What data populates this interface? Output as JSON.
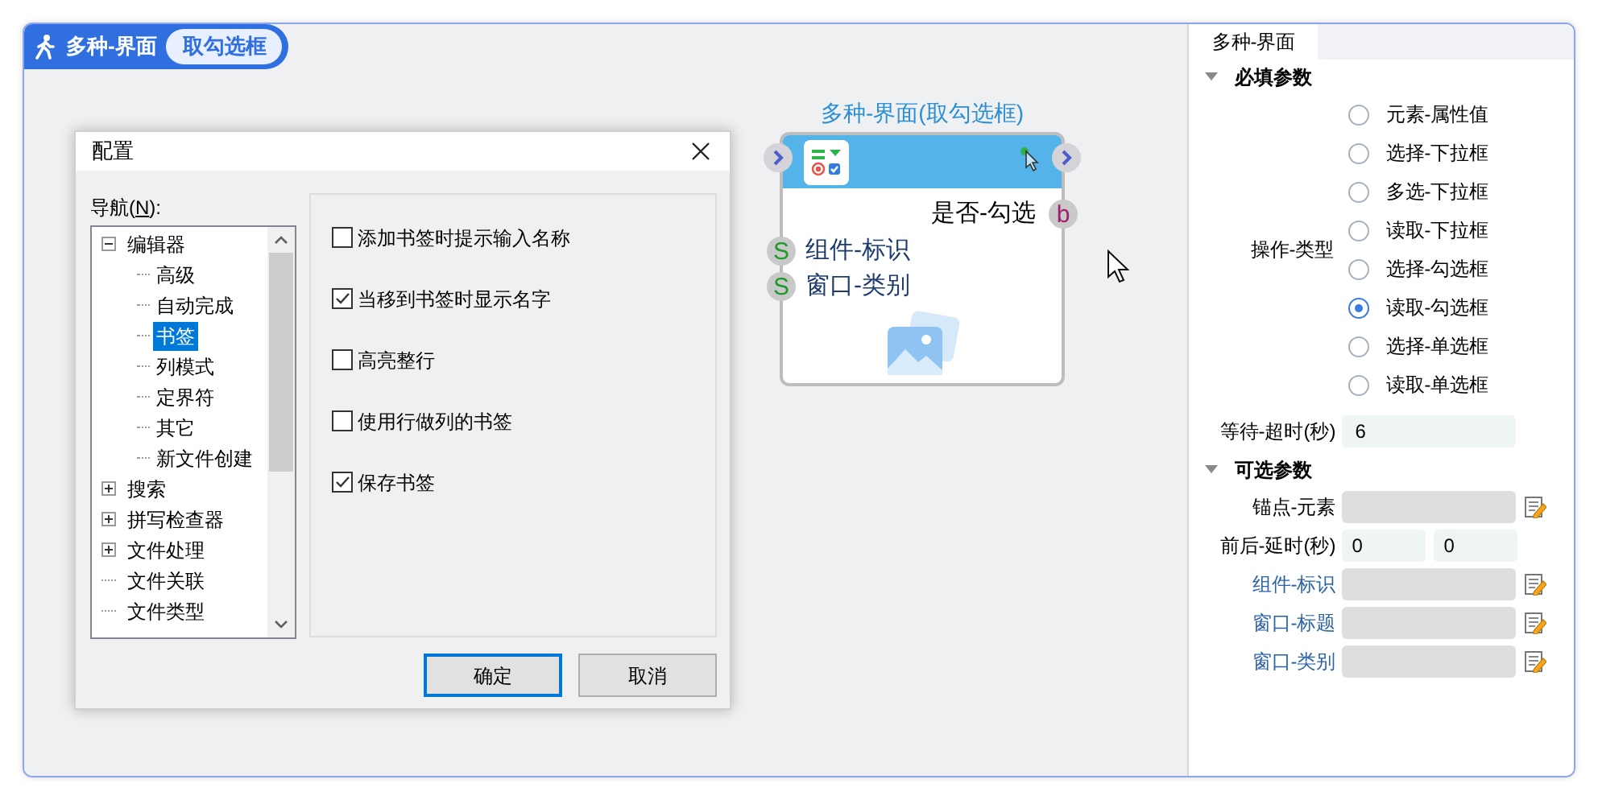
{
  "header": {
    "title": "多种-界面",
    "badge": "取勾选框"
  },
  "dialog": {
    "title": "配置",
    "nav_label_parts": [
      "导航(",
      "N",
      "):"
    ],
    "tree": [
      {
        "label": "编辑器",
        "expanded": true,
        "selected": false,
        "children": [
          {
            "label": "高级",
            "selected": false
          },
          {
            "label": "自动完成",
            "selected": false
          },
          {
            "label": "书签",
            "selected": true
          },
          {
            "label": "列模式",
            "selected": false
          },
          {
            "label": "定界符",
            "selected": false
          },
          {
            "label": "其它",
            "selected": false
          },
          {
            "label": "新文件创建",
            "selected": false
          }
        ]
      },
      {
        "label": "搜索",
        "expanded": false,
        "selected": false
      },
      {
        "label": "拼写检查器",
        "expanded": false,
        "selected": false
      },
      {
        "label": "文件处理",
        "expanded": false,
        "selected": false
      },
      {
        "label": "文件关联",
        "selected": false
      },
      {
        "label": "文件类型",
        "selected": false
      }
    ],
    "options": [
      {
        "label": "添加书签时提示输入名称",
        "checked": false
      },
      {
        "label": "当移到书签时显示名字",
        "checked": true
      },
      {
        "label": "高亮整行",
        "checked": false
      },
      {
        "label": "使用行做列的书签",
        "checked": false
      },
      {
        "label": "保存书签",
        "checked": true
      }
    ],
    "buttons": [
      {
        "label": "确定",
        "default": true
      },
      {
        "label": "取消",
        "default": false
      }
    ]
  },
  "node": {
    "title": "多种-界面(取勾选框)",
    "output": {
      "label": "是否-勾选",
      "port": "b"
    },
    "inputs": [
      {
        "label": "组件-标识",
        "port": "S"
      },
      {
        "label": "窗口-类别",
        "port": "S"
      }
    ]
  },
  "panel": {
    "tab": "多种-界面",
    "required": {
      "title": "必填参数",
      "expanded": true,
      "operation_label": "操作-类型",
      "options": [
        {
          "label": "元素-属性值",
          "selected": false
        },
        {
          "label": "选择-下拉框",
          "selected": false
        },
        {
          "label": "多选-下拉框",
          "selected": false
        },
        {
          "label": "读取-下拉框",
          "selected": false
        },
        {
          "label": "选择-勾选框",
          "selected": false
        },
        {
          "label": "读取-勾选框",
          "selected": true
        },
        {
          "label": "选择-单选框",
          "selected": false
        },
        {
          "label": "读取-单选框",
          "selected": false
        }
      ],
      "wait_label": "等待-超时(秒)",
      "wait_value": "6"
    },
    "optional": {
      "title": "可选参数",
      "expanded": true,
      "rows": [
        {
          "kind": "field",
          "label": "锚点-元素",
          "linked": false
        },
        {
          "kind": "pair",
          "label": "前后-延时(秒)",
          "linked": false,
          "values": [
            "0",
            "0"
          ]
        },
        {
          "kind": "field",
          "label": "组件-标识",
          "linked": true
        },
        {
          "kind": "field",
          "label": "窗口-标题",
          "linked": true
        },
        {
          "kind": "field",
          "label": "窗口-类别",
          "linked": true
        }
      ]
    }
  }
}
